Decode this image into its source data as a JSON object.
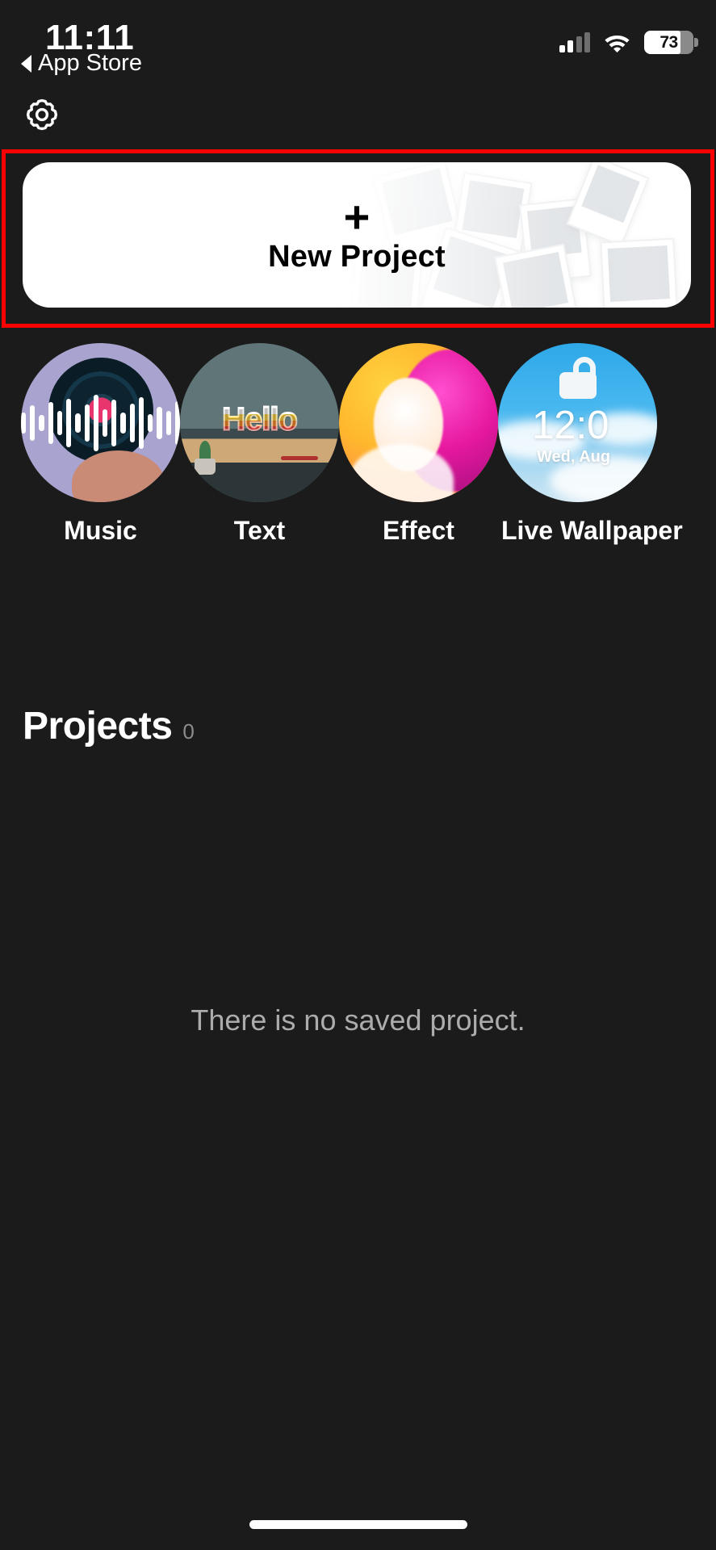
{
  "status_bar": {
    "time": "11:11",
    "battery_percent": "73",
    "battery_level": 73,
    "cellular_icon": "cellular-signal-icon",
    "wifi_icon": "wifi-icon",
    "battery_icon": "battery-icon"
  },
  "back_chip": {
    "label": "App Store",
    "icon": "back-triangle-icon"
  },
  "toolbar": {
    "settings_icon": "gear-icon"
  },
  "highlight": {
    "color": "#ff0000"
  },
  "new_project": {
    "plus": "+",
    "label": "New Project"
  },
  "categories": [
    {
      "label": "Music",
      "art": "vinyl-waveform"
    },
    {
      "label": "Text",
      "art": "hello-desk",
      "overlay_text": "Hello"
    },
    {
      "label": "Effect",
      "art": "pink-hair-portrait"
    },
    {
      "label": "Live Wallpaper",
      "art": "lockscreen-sky",
      "clock": "12:0",
      "date": "Wed, Aug"
    }
  ],
  "projects": {
    "title": "Projects",
    "count": "0",
    "empty_message": "There is no saved project."
  },
  "theme": {
    "background": "#1b1b1b",
    "card_background": "#ffffff",
    "accent_highlight": "#ff0000",
    "text_primary": "#ffffff",
    "text_secondary": "#acacac"
  }
}
